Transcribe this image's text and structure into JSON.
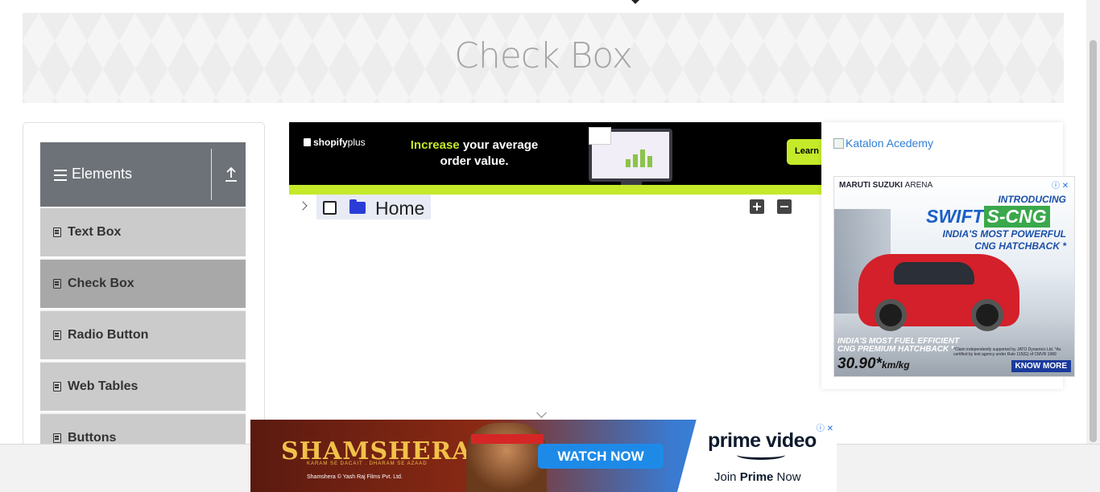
{
  "page": {
    "title": "Check Box"
  },
  "sidebar": {
    "group_title": "Elements",
    "items": [
      {
        "label": "Text Box"
      },
      {
        "label": "Check Box",
        "active": true
      },
      {
        "label": "Radio Button"
      },
      {
        "label": "Web Tables"
      },
      {
        "label": "Buttons"
      }
    ]
  },
  "tree": {
    "root_label": "Home",
    "checked": false,
    "expanded": false
  },
  "ad_top": {
    "brand": "shopify",
    "brand_suffix": "plus",
    "headline_highlight": "Increase",
    "headline_rest": " your average order value.",
    "cta": "Learn"
  },
  "right_ad": {
    "broken_image_alt": "Katalon Acedemy",
    "brand": "MARUTI SUZUKI",
    "brand_arena": "ARENA",
    "intro": "INTRODUCING",
    "model": "SWIFT",
    "variant": "S-CNG",
    "tagline_1": "INDIA'S MOST POWERFUL",
    "tagline_2": "CNG HATCHBACK *",
    "fuel_1": "INDIA'S MOST FUEL EFFICIENT",
    "fuel_2": "CNG PREMIUM HATCHBACK *",
    "mileage": "30.90*",
    "mileage_unit": "km/kg",
    "claim": "*Claim independently supported by JATO Dynamics Ltd. *As certified by test agency under Rule 115(G) of CMVR 1989",
    "cta": "KNOW MORE"
  },
  "bottom_ad": {
    "movie": "SHAMSHERA",
    "tagline": "KARAM SE DACAIT . DHARAM SE AZAAD",
    "credit": "Shamshera © Yash Raj Films Pvt. Ltd.",
    "cta": "WATCH NOW",
    "brand": "prime video",
    "join_prefix": "Join ",
    "join_bold": "Prime",
    "join_suffix": " Now"
  },
  "colors": {
    "header_gray": "#6d7278",
    "menu_gray": "#cbcbcb",
    "menu_active": "#a8a8a8",
    "folder_blue": "#2a3cd6",
    "ad_lime": "#c4ea2a"
  }
}
